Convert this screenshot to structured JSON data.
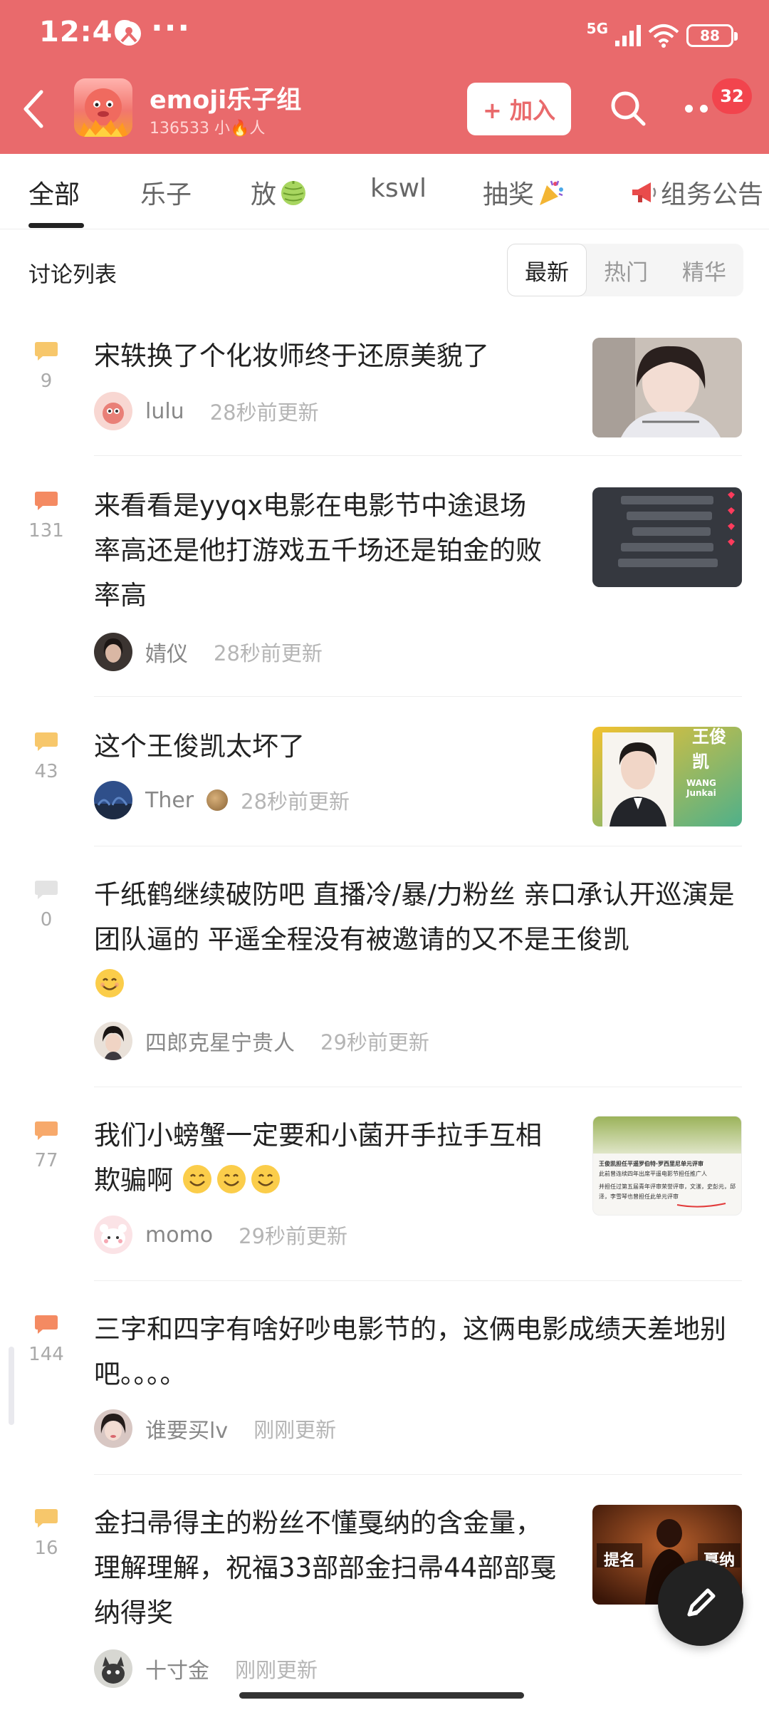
{
  "status_bar": {
    "time": "12:46",
    "network": "5G",
    "battery": "88"
  },
  "group": {
    "name": "emoji乐子组",
    "meta": "136533 小🔥人",
    "join_label": "+ 加入",
    "notification_count": "32"
  },
  "tabs": [
    {
      "label": "全部",
      "active": true
    },
    {
      "label": "乐子"
    },
    {
      "label": "放"
    },
    {
      "label": "kswl"
    },
    {
      "label": "抽奖"
    },
    {
      "label": "组务公告"
    }
  ],
  "list": {
    "title": "讨论列表",
    "sort_options": [
      "最新",
      "热门",
      "精华"
    ],
    "sort_active": "最新"
  },
  "posts": [
    {
      "title": "宋轶换了个化妆师终于还原美貌了",
      "comments": "9",
      "author": "lulu",
      "time": "28秒前更新",
      "icon_color": "#f7c76b"
    },
    {
      "title": "来看看是yyqx电影在电影节中途退场率高还是他打游戏五千场还是铂金的败率高",
      "comments": "131",
      "author": "婧仪",
      "time": "28秒前更新",
      "icon_color": "#f48a62"
    },
    {
      "title": "这个王俊凯太坏了",
      "comments": "43",
      "author": "Ther",
      "time": "28秒前更新",
      "icon_color": "#f7c76b"
    },
    {
      "title": "千纸鹤继续破防吧 直播冷/暴/力粉丝 亲口承认开巡演是团队逼的 平遥全程没有被邀请的又不是王俊凯",
      "comments": "0",
      "author": "四郎克星宁贵人",
      "time": "29秒前更新",
      "icon_color": "#e3e3e3"
    },
    {
      "title": "我们小螃蟹一定要和小菌开手拉手互相欺骗啊",
      "comments": "77",
      "author": "momo",
      "time": "29秒前更新",
      "icon_color": "#f7a96b"
    },
    {
      "title": "三字和四字有啥好吵电影节的，这俩电影成绩天差地别吧。。。。",
      "comments": "144",
      "author": "谁要买lv",
      "time": "刚刚更新",
      "icon_color": "#f48a62"
    },
    {
      "title": "金扫帚得主的粉丝不懂戛纳的含金量，理解理解，祝福33部部金扫帚44部部戛纳得奖",
      "comments": "16",
      "author": "十寸金",
      "time": "刚刚更新",
      "icon_color": "#f7c76b"
    }
  ],
  "thumb_text": {
    "wang": "WANG Junkai",
    "wang_top": "王俊凯",
    "news_line1": "王俊凯担任平遥罗伯特·罗西里尼单元评审",
    "news_line2": "此前曾连续四年出席平遥电影节担任推广人",
    "news_line3": "并担任过第五届青年评审荣誉评审，文漾，史彭元，邱泽，李雪琴也曾担任此单元评审",
    "cannes_a": "提名",
    "cannes_b": "戛纳"
  }
}
